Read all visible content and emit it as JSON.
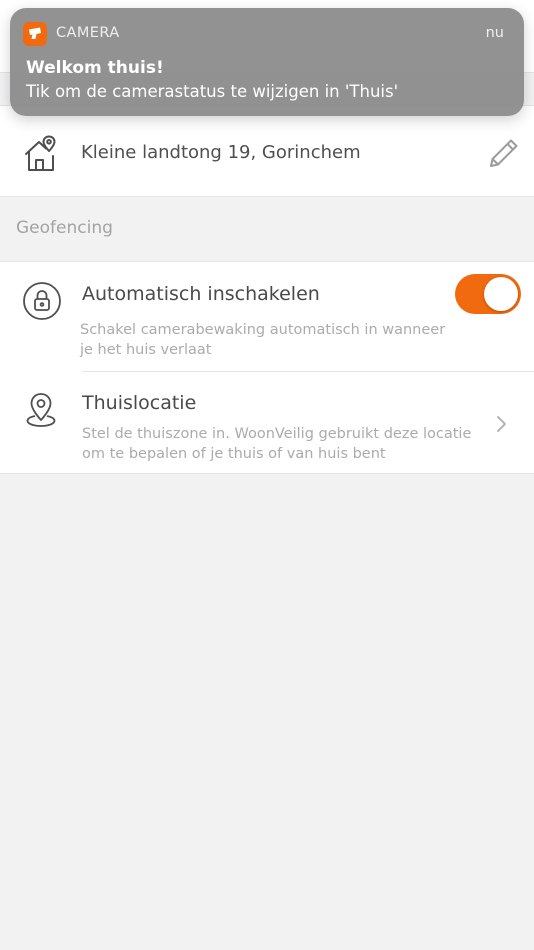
{
  "notification": {
    "app_name": "CAMERA",
    "time": "nu",
    "title": "Welkom thuis!",
    "body": "Tik om de camerastatus te wijzigen in 'Thuis'",
    "app_icon": "camera-app-icon"
  },
  "address": {
    "text": "Kleine landtong 19, Gorinchem",
    "icon": "house-location-icon",
    "edit_icon": "pencil-icon"
  },
  "geofencing": {
    "section_title": "Geofencing",
    "auto_enable": {
      "title": "Automatisch inschakelen",
      "description": "Schakel camerabewaking automatisch in wanneer je het huis verlaat",
      "icon": "lock-icon",
      "enabled": true
    },
    "home_location": {
      "title": "Thuislocatie",
      "description": "Stel de thuiszone in. WoonVeilig gebruikt deze locatie om te bepalen of je thuis of van huis bent",
      "icon": "map-pin-icon",
      "chevron": "chevron-right-icon"
    }
  },
  "colors": {
    "accent": "#f26a10",
    "background": "#f2f2f3",
    "text_primary": "#4a4a4a",
    "text_secondary": "#ababab"
  }
}
